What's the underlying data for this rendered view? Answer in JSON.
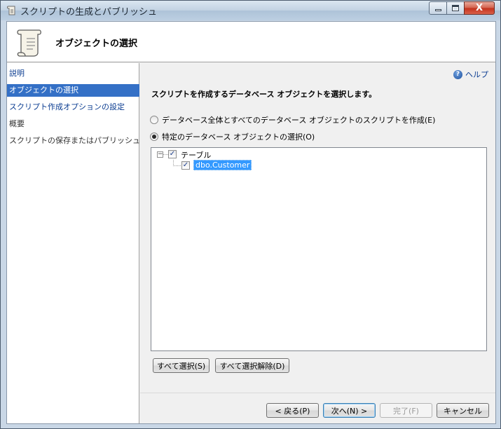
{
  "window": {
    "title": "スクリプトの生成とパブリッシュ",
    "close_glyph": "X"
  },
  "header": {
    "page_title": "オブジェクトの選択"
  },
  "sidebar": {
    "items": [
      {
        "label": "説明"
      },
      {
        "label": "オブジェクトの選択"
      },
      {
        "label": "スクリプト作成オプションの設定"
      },
      {
        "label": "概要"
      },
      {
        "label": "スクリプトの保存またはパブリッシュ"
      }
    ]
  },
  "main": {
    "help_label": "ヘルプ",
    "help_glyph": "?",
    "instruction": "スクリプトを作成するデータベース オブジェクトを選択します。",
    "radio_all_label": "データベース全体とすべてのデータベース オブジェクトのスクリプトを作成(E)",
    "radio_specific_label": "特定のデータベース オブジェクトの選択(O)",
    "radio_selected": "specific",
    "tree": {
      "expander_glyph": "−",
      "check_glyph": "✓",
      "root": {
        "label": "テーブル",
        "checked": true
      },
      "children": [
        {
          "label": "dbo.Customer",
          "checked": true,
          "selected": true
        }
      ]
    },
    "select_all_label": "すべて選択(S)",
    "deselect_all_label": "すべて選択解除(D)"
  },
  "footer": {
    "back_label": "< 戻る(P)",
    "next_label": "次へ(N) >",
    "finish_label": "完了(F)",
    "cancel_label": "キャンセル"
  },
  "colors": {
    "selection": "#3470c6",
    "link": "#0b3d91",
    "close_button": "#c2301b"
  }
}
